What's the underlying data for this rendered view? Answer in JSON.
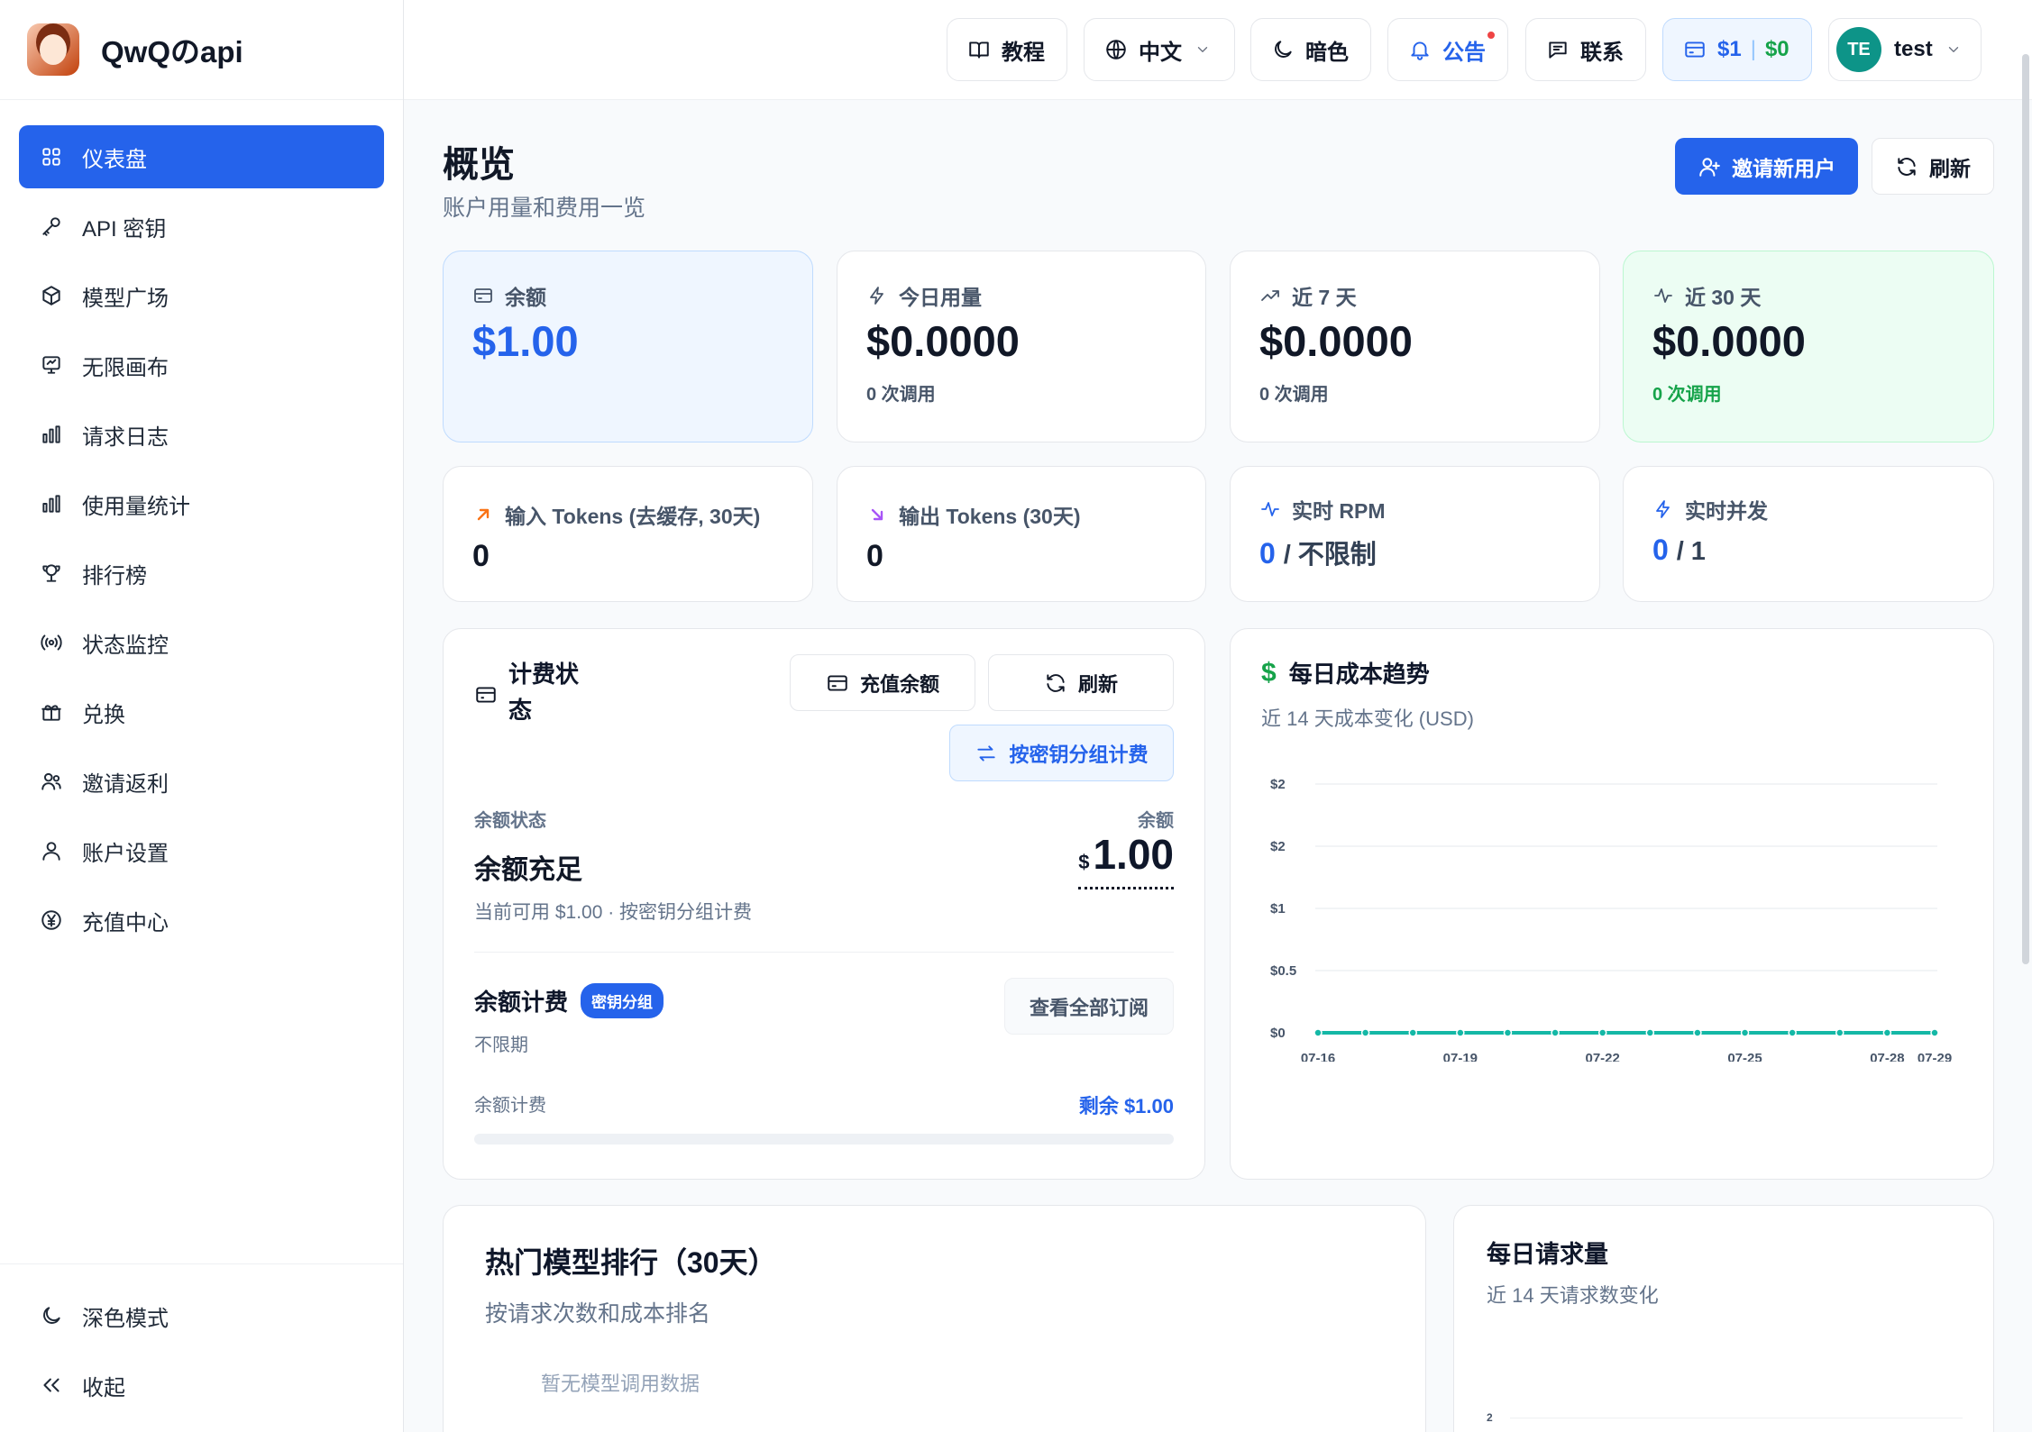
{
  "brand": {
    "name": "QwQのapi"
  },
  "sidebar": {
    "items": [
      {
        "label": "仪表盘",
        "icon": "grid-icon",
        "active": true
      },
      {
        "label": "API 密钥",
        "icon": "key-icon"
      },
      {
        "label": "模型广场",
        "icon": "cube-icon"
      },
      {
        "label": "无限画布",
        "icon": "canvas-icon"
      },
      {
        "label": "请求日志",
        "icon": "bar-chart-icon"
      },
      {
        "label": "使用量统计",
        "icon": "bar-chart-icon"
      },
      {
        "label": "排行榜",
        "icon": "trophy-icon"
      },
      {
        "label": "状态监控",
        "icon": "broadcast-icon"
      },
      {
        "label": "兑换",
        "icon": "gift-icon"
      },
      {
        "label": "邀请返利",
        "icon": "users-icon"
      },
      {
        "label": "账户设置",
        "icon": "user-icon"
      },
      {
        "label": "充值中心",
        "icon": "yen-icon"
      }
    ],
    "bottom": {
      "dark_mode": "深色模式",
      "collapse": "收起"
    }
  },
  "header": {
    "tutorial": "教程",
    "language": "中文",
    "theme": "暗色",
    "notice": "公告",
    "contact": "联系",
    "balance": "$1",
    "usage": "$0",
    "avatar_initials": "TE",
    "username": "test"
  },
  "page": {
    "title": "概览",
    "subtitle": "账户用量和费用一览",
    "invite_button": "邀请新用户",
    "refresh_button": "刷新"
  },
  "stats": {
    "balance": {
      "label": "余额",
      "value": "$1.00"
    },
    "today": {
      "label": "今日用量",
      "value": "$0.0000",
      "calls": "0 次调用"
    },
    "week": {
      "label": "近 7 天",
      "value": "$0.0000",
      "calls": "0 次调用"
    },
    "month": {
      "label": "近 30 天",
      "value": "$0.0000",
      "calls": "0 次调用"
    },
    "input_tokens": {
      "label": "输入 Tokens (去缓存, 30天)",
      "value": "0"
    },
    "output_tokens": {
      "label": "输出 Tokens (30天)",
      "value": "0"
    },
    "rpm": {
      "label": "实时 RPM",
      "value": "0",
      "limit": "/ 不限制"
    },
    "concurrency": {
      "label": "实时并发",
      "value": "0",
      "limit": "/ 1"
    }
  },
  "billing": {
    "title_line1": "计费状",
    "title_line2": "态",
    "recharge_button": "充值余额",
    "refresh_button": "刷新",
    "group_billing_button": "按密钥分组计费",
    "status_label": "余额状态",
    "status_value": "余额充足",
    "balance_label": "余额",
    "balance_currency": "$",
    "balance_amount": "1.00",
    "status_desc": "当前可用 $1.00 · 按密钥分组计费",
    "plan_title": "余额计费",
    "plan_badge": "密钥分组",
    "plan_period": "不限期",
    "view_all_button": "查看全部订阅",
    "progress_label": "余额计费",
    "remaining": "剩余 $1.00",
    "progress_fraction": 0
  },
  "cost_trend": {
    "title": "每日成本趋势",
    "subtitle": "近 14 天成本变化 (USD)"
  },
  "top_models": {
    "title": "热门模型排行（30天）",
    "subtitle": "按请求次数和成本排名",
    "empty": "暂无模型调用数据"
  },
  "daily_requests": {
    "title": "每日请求量",
    "subtitle": "近 14 天请求数变化",
    "y_tick": "2"
  },
  "colors": {
    "accent": "#2563eb",
    "success": "#16a34a",
    "line": "#14b8a6"
  },
  "chart_data": {
    "type": "line",
    "title": "每日成本趋势",
    "x": [
      "07-16",
      "07-17",
      "07-18",
      "07-19",
      "07-20",
      "07-21",
      "07-22",
      "07-23",
      "07-24",
      "07-25",
      "07-26",
      "07-27",
      "07-28",
      "07-29"
    ],
    "x_tick_labels": [
      "07-16",
      "07-19",
      "07-22",
      "07-25",
      "07-28",
      "07-29"
    ],
    "y_tick_labels": [
      "$2",
      "$2",
      "$1",
      "$0.5",
      "$0"
    ],
    "y_ticks": [
      2,
      1.5,
      1,
      0.5,
      0
    ],
    "ylim": [
      0,
      2
    ],
    "series": [
      {
        "values": [
          0,
          0,
          0,
          0,
          0,
          0,
          0,
          0,
          0,
          0,
          0,
          0,
          0,
          0
        ]
      }
    ],
    "grid": true
  }
}
